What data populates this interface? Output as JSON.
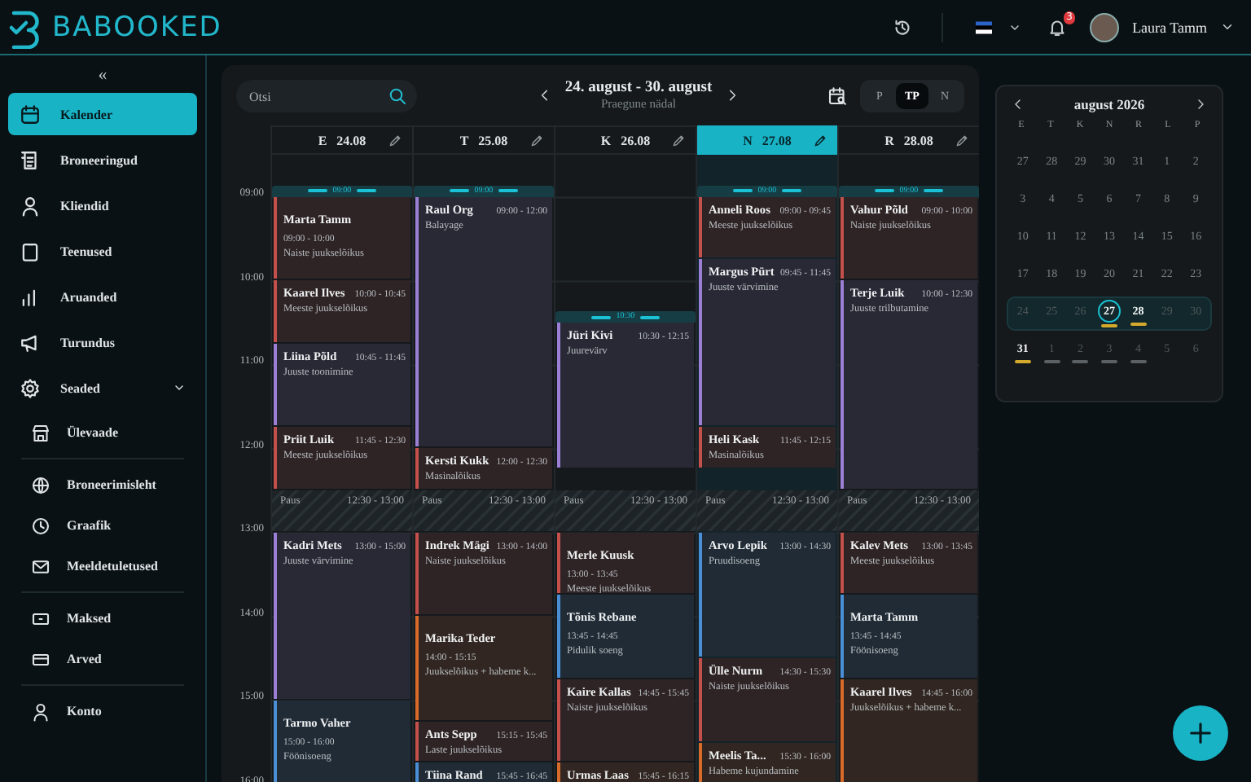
{
  "topbar": {
    "logo": "BABOOKED",
    "notifications": {
      "count": "3"
    },
    "user": {
      "name": "Laura Tamm"
    }
  },
  "sidebar": {
    "collapse": "«",
    "items": [
      {
        "label": "Kalender",
        "selected": true
      },
      {
        "label": "Broneeringud",
        "selected": false
      },
      {
        "label": "Kliendid",
        "selected": false
      },
      {
        "label": "Teenused",
        "selected": false
      },
      {
        "label": "Aruanded",
        "selected": false
      },
      {
        "label": "Turundus",
        "selected": false
      },
      {
        "label": "Seaded",
        "selected": false,
        "expanded": true,
        "groups": [
          [
            {
              "label": "Ülevaade"
            }
          ],
          [
            {
              "label": "Broneerimisleht"
            },
            {
              "label": "Graafik"
            },
            {
              "label": "Meeldetuletused"
            }
          ],
          [
            {
              "label": "Maksed"
            },
            {
              "label": "Arved"
            }
          ],
          [
            {
              "label": "Konto"
            }
          ]
        ]
      }
    ]
  },
  "toolbar": {
    "search": {
      "placeholder": "Otsi"
    },
    "range": "24. august - 30. august",
    "range_note": "Praegune nädal",
    "views": [
      {
        "label": "P",
        "selected": false
      },
      {
        "label": "TP",
        "selected": true
      },
      {
        "label": "N",
        "selected": false
      }
    ]
  },
  "hours": [
    "09:00",
    "10:00",
    "11:00",
    "12:00",
    "13:00",
    "14:00",
    "15:00",
    "16:00"
  ],
  "days": [
    {
      "weekday": "E",
      "date": "24.08",
      "selected": false,
      "marker": "09:00",
      "events": [
        {
          "kind": "stacked",
          "name": "Marta Tamm",
          "time": "09:00 - 10:00",
          "service": "Naiste juukselõikus",
          "color": "#c4504c"
        },
        {
          "kind": "booking",
          "name": "Kaarel Ilves",
          "time": "10:00 - 10:45",
          "service": "Meeste juukselõikus",
          "color": "#c4504c"
        },
        {
          "kind": "booking",
          "name": "Liina Põld",
          "time": "10:45 - 11:45",
          "service": "Juuste toonimine",
          "color": "#9b7fd4"
        },
        {
          "kind": "booking",
          "name": "Priit Luik",
          "time": "11:45 - 12:30",
          "service": "Meeste juukselõikus",
          "color": "#c4504c"
        },
        {
          "kind": "break",
          "name": "Paus",
          "time": "12:30 - 13:00"
        },
        {
          "kind": "booking",
          "name": "Kadri Mets",
          "time": "13:00 - 15:00",
          "service": "Juuste värvimine",
          "color": "#9b7fd4"
        },
        {
          "kind": "stacked",
          "name": "Tarmo Vaher",
          "time": "15:00 - 16:00",
          "service": "Föönisoeng",
          "color": "#4a8fd6"
        }
      ]
    },
    {
      "weekday": "T",
      "date": "25.08",
      "selected": false,
      "marker": "09:00",
      "events": [
        {
          "kind": "booking",
          "name": "Raul Org",
          "time": "09:00 - 12:00",
          "service": "Balayage",
          "color": "#9b7fd4"
        },
        {
          "kind": "booking",
          "name": "Kersti Kukk",
          "time": "12:00 - 12:30",
          "service": "Masinalõikus",
          "color": "#c4504c"
        },
        {
          "kind": "break",
          "name": "Paus",
          "time": "12:30 - 13:00"
        },
        {
          "kind": "booking",
          "name": "Indrek Mägi",
          "time": "13:00 - 14:00",
          "service": "Naiste juukselõikus",
          "color": "#c4504c"
        },
        {
          "kind": "stacked",
          "name": "Marika Teder",
          "time": "14:00 - 15:15",
          "service": "Juukselõikus + habeme k...",
          "color": "#d86a2a"
        },
        {
          "kind": "booking",
          "name": "Ants Sepp",
          "time": "15:15 - 15:45",
          "service": "Laste juukselõikus",
          "color": "#c4504c"
        },
        {
          "kind": "booking",
          "name": "Tiina Rand",
          "time": "15:45 - 16:45",
          "color": "#4a8fd6"
        }
      ]
    },
    {
      "weekday": "K",
      "date": "26.08",
      "selected": false,
      "marker": "10:30",
      "events": [
        {
          "kind": "booking",
          "name": "Jüri Kivi",
          "time": "10:30 - 12:15",
          "service": "Juurevärv",
          "color": "#9b7fd4"
        },
        {
          "kind": "break",
          "name": "Paus",
          "time": "12:30 - 13:00"
        },
        {
          "kind": "stacked",
          "name": "Merle Kuusk",
          "time": "13:00 - 13:45",
          "service": "Meeste juukselõikus",
          "color": "#c4504c"
        },
        {
          "kind": "stacked",
          "name": "Tõnis Rebane",
          "time": "13:45 - 14:45",
          "service": "Pidulik soeng",
          "color": "#4a8fd6"
        },
        {
          "kind": "booking",
          "name": "Kaire Kallas",
          "time": "14:45 - 15:45",
          "service": "Naiste juukselõikus",
          "color": "#c4504c"
        },
        {
          "kind": "booking",
          "name": "Urmas Laas",
          "time": "15:45 - 16:15",
          "color": "#d86a2a"
        }
      ]
    },
    {
      "weekday": "N",
      "date": "27.08",
      "selected": true,
      "marker": "09:00",
      "events": [
        {
          "kind": "booking",
          "name": "Anneli Roos",
          "time": "09:00 - 09:45",
          "service": "Meeste juukselõikus",
          "color": "#c4504c"
        },
        {
          "kind": "booking",
          "name": "Margus Pürt",
          "time": "09:45 - 11:45",
          "service": "Juuste värvimine",
          "color": "#9b7fd4"
        },
        {
          "kind": "booking",
          "name": "Heli Kask",
          "time": "11:45 - 12:15",
          "service": "Masinalõikus",
          "color": "#c4504c"
        },
        {
          "kind": "break",
          "name": "Paus",
          "time": "12:30 - 13:00"
        },
        {
          "kind": "booking",
          "name": "Arvo Lepik",
          "time": "13:00 - 14:30",
          "service": "Pruudisoeng",
          "color": "#4a8fd6"
        },
        {
          "kind": "booking",
          "name": "Ülle Nurm",
          "time": "14:30 - 15:30",
          "service": "Naiste juukselõikus",
          "color": "#c4504c"
        },
        {
          "kind": "booking",
          "name": "Meelis Ta...",
          "time": "15:30 - 16:00",
          "service": "Habeme kujundamine",
          "color": "#d86a2a"
        }
      ]
    },
    {
      "weekday": "R",
      "date": "28.08",
      "selected": false,
      "marker": "09:00",
      "events": [
        {
          "kind": "booking",
          "name": "Vahur Põld",
          "time": "09:00 - 10:00",
          "service": "Naiste juukselõikus",
          "color": "#c4504c"
        },
        {
          "kind": "booking",
          "name": "Terje Luik",
          "time": "10:00 - 12:30",
          "service": "Juuste trilbutamine",
          "color": "#9b7fd4"
        },
        {
          "kind": "break",
          "name": "Paus",
          "time": "12:30 - 13:00"
        },
        {
          "kind": "booking",
          "name": "Kalev Mets",
          "time": "13:00 - 13:45",
          "service": "Meeste juukselõikus",
          "color": "#c4504c"
        },
        {
          "kind": "stacked",
          "name": "Marta Tamm",
          "time": "13:45 - 14:45",
          "service": "Föönisoeng",
          "color": "#4a8fd6"
        },
        {
          "kind": "booking",
          "name": "Kaarel Ilves",
          "time": "14:45 - 16:00",
          "service": "Juukselõikus + habeme k...",
          "color": "#d86a2a"
        }
      ]
    }
  ],
  "mini_calendar": {
    "title": "august 2026",
    "weekdays": [
      "E",
      "T",
      "K",
      "N",
      "R",
      "L",
      "P"
    ],
    "weeks": [
      {
        "selected": false,
        "days": [
          {
            "text": "27",
            "kind": "normal"
          },
          {
            "text": "28",
            "kind": "normal"
          },
          {
            "text": "29",
            "kind": "normal"
          },
          {
            "text": "30",
            "kind": "normal"
          },
          {
            "text": "31",
            "kind": "normal"
          },
          {
            "text": "1",
            "kind": "normal"
          },
          {
            "text": "2",
            "kind": "normal"
          }
        ]
      },
      {
        "selected": false,
        "days": [
          {
            "text": "3",
            "kind": "normal"
          },
          {
            "text": "4",
            "kind": "normal"
          },
          {
            "text": "5",
            "kind": "normal"
          },
          {
            "text": "6",
            "kind": "normal"
          },
          {
            "text": "7",
            "kind": "normal"
          },
          {
            "text": "8",
            "kind": "normal"
          },
          {
            "text": "9",
            "kind": "normal"
          }
        ]
      },
      {
        "selected": false,
        "days": [
          {
            "text": "10",
            "kind": "normal"
          },
          {
            "text": "11",
            "kind": "normal"
          },
          {
            "text": "12",
            "kind": "normal"
          },
          {
            "text": "13",
            "kind": "normal"
          },
          {
            "text": "14",
            "kind": "normal"
          },
          {
            "text": "15",
            "kind": "normal"
          },
          {
            "text": "16",
            "kind": "normal"
          }
        ]
      },
      {
        "selected": false,
        "days": [
          {
            "text": "17",
            "kind": "normal"
          },
          {
            "text": "18",
            "kind": "normal"
          },
          {
            "text": "19",
            "kind": "normal"
          },
          {
            "text": "20",
            "kind": "normal"
          },
          {
            "text": "21",
            "kind": "normal"
          },
          {
            "text": "22",
            "kind": "normal"
          },
          {
            "text": "23",
            "kind": "normal"
          }
        ]
      },
      {
        "selected": true,
        "days": [
          {
            "text": "24",
            "kind": "dim"
          },
          {
            "text": "25",
            "kind": "dim"
          },
          {
            "text": "26",
            "kind": "dim"
          },
          {
            "text": "27",
            "kind": "today",
            "color": "#d4aa2c"
          },
          {
            "text": "28",
            "kind": "bold",
            "color": "#d4aa2c"
          },
          {
            "text": "29",
            "kind": "dim"
          },
          {
            "text": "30",
            "kind": "dim"
          }
        ]
      },
      {
        "selected": false,
        "days": [
          {
            "text": "31",
            "kind": "bold",
            "color": "#d4aa2c"
          },
          {
            "text": "1",
            "kind": "dim",
            "color": "#5a6064"
          },
          {
            "text": "2",
            "kind": "dim",
            "color": "#5a6064"
          },
          {
            "text": "3",
            "kind": "dim",
            "color": "#5a6064"
          },
          {
            "text": "4",
            "kind": "dim",
            "color": "#5a6064"
          },
          {
            "text": "5",
            "kind": "dim"
          },
          {
            "text": "6",
            "kind": "dim"
          }
        ]
      }
    ]
  }
}
